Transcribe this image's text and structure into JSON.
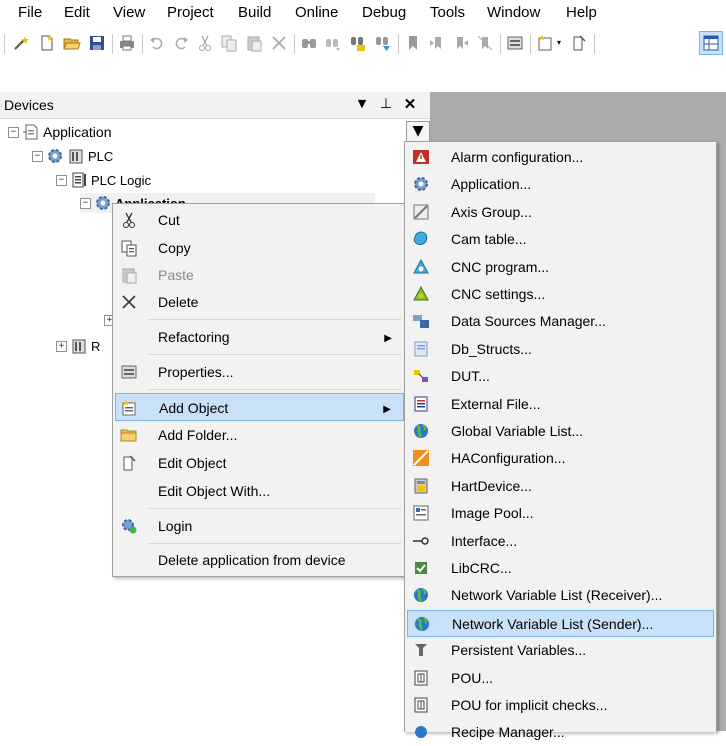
{
  "menubar": {
    "items": [
      "File",
      "Edit",
      "View",
      "Project",
      "Build",
      "Online",
      "Debug",
      "Tools",
      "Window",
      "Help"
    ]
  },
  "devices_panel": {
    "title": "Devices",
    "tree": {
      "application_root": "Application",
      "plc": "PLC",
      "plc_logic": "PLC Logic",
      "application_child": "Application",
      "partial_node": "R"
    }
  },
  "context_menu": {
    "cut": "Cut",
    "copy": "Copy",
    "paste": "Paste",
    "delete": "Delete",
    "refactoring": "Refactoring",
    "properties": "Properties...",
    "add_object": "Add Object",
    "add_folder": "Add Folder...",
    "edit_object": "Edit Object",
    "edit_object_with": "Edit Object With...",
    "login": "Login",
    "delete_application": "Delete application from device"
  },
  "submenu": {
    "items": [
      {
        "label": "Alarm configuration...",
        "icon": "alarm-icon"
      },
      {
        "label": "Application...",
        "icon": "gear-icon"
      },
      {
        "label": "Axis Group...",
        "icon": "axis-group-icon"
      },
      {
        "label": "Cam table...",
        "icon": "cam-table-icon"
      },
      {
        "label": "CNC program...",
        "icon": "cnc-program-icon"
      },
      {
        "label": "CNC settings...",
        "icon": "cnc-settings-icon"
      },
      {
        "label": "Data Sources Manager...",
        "icon": "data-sources-icon"
      },
      {
        "label": "Db_Structs...",
        "icon": "db-structs-icon"
      },
      {
        "label": "DUT...",
        "icon": "dut-icon"
      },
      {
        "label": "External File...",
        "icon": "external-file-icon"
      },
      {
        "label": "Global Variable List...",
        "icon": "globe-icon"
      },
      {
        "label": "HAConfiguration...",
        "icon": "ha-config-icon"
      },
      {
        "label": "HartDevice...",
        "icon": "hart-device-icon"
      },
      {
        "label": "Image Pool...",
        "icon": "image-pool-icon"
      },
      {
        "label": "Interface...",
        "icon": "interface-icon"
      },
      {
        "label": "LibCRC...",
        "icon": "libcrc-icon"
      },
      {
        "label": "Network Variable List (Receiver)...",
        "icon": "globe-icon"
      },
      {
        "label": "Network Variable List (Sender)...",
        "icon": "globe-icon"
      },
      {
        "label": "Persistent Variables...",
        "icon": "persistent-variables-icon"
      },
      {
        "label": "POU...",
        "icon": "pou-icon"
      },
      {
        "label": "POU for implicit checks...",
        "icon": "pou-icon"
      },
      {
        "label": "Recipe Manager...",
        "icon": "recipe-manager-icon"
      }
    ],
    "highlighted_index": 17
  },
  "colors": {
    "highlight_bg": "#c8e1f9",
    "highlight_border": "#7ab4e8",
    "menu_bg": "#f2f2f2",
    "workspace_gray": "#ababab"
  }
}
